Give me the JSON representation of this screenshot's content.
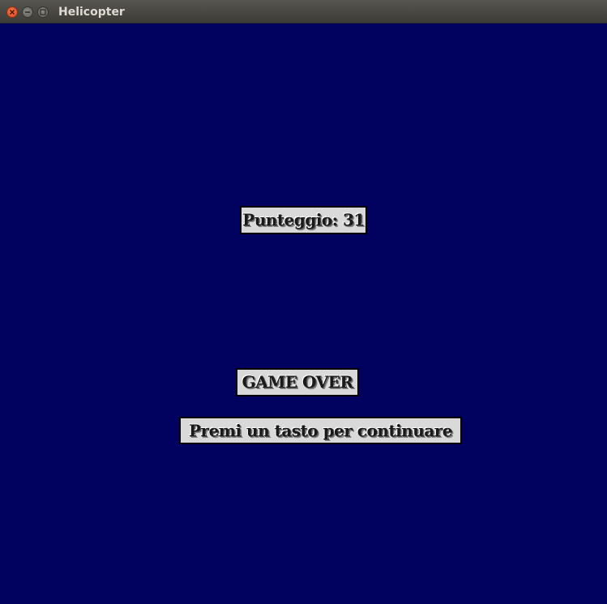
{
  "window": {
    "title": "Helicopter"
  },
  "game": {
    "score_text": "Punteggio: 31",
    "game_over_text": "GAME OVER",
    "continue_prompt": "Premi un tasto per continuare"
  },
  "colors": {
    "background": "#010160",
    "label_fill": "#d9d9d9",
    "label_border": "#000000"
  },
  "icons": {
    "close": "close-icon",
    "minimize": "minimize-icon",
    "maximize": "maximize-icon"
  }
}
